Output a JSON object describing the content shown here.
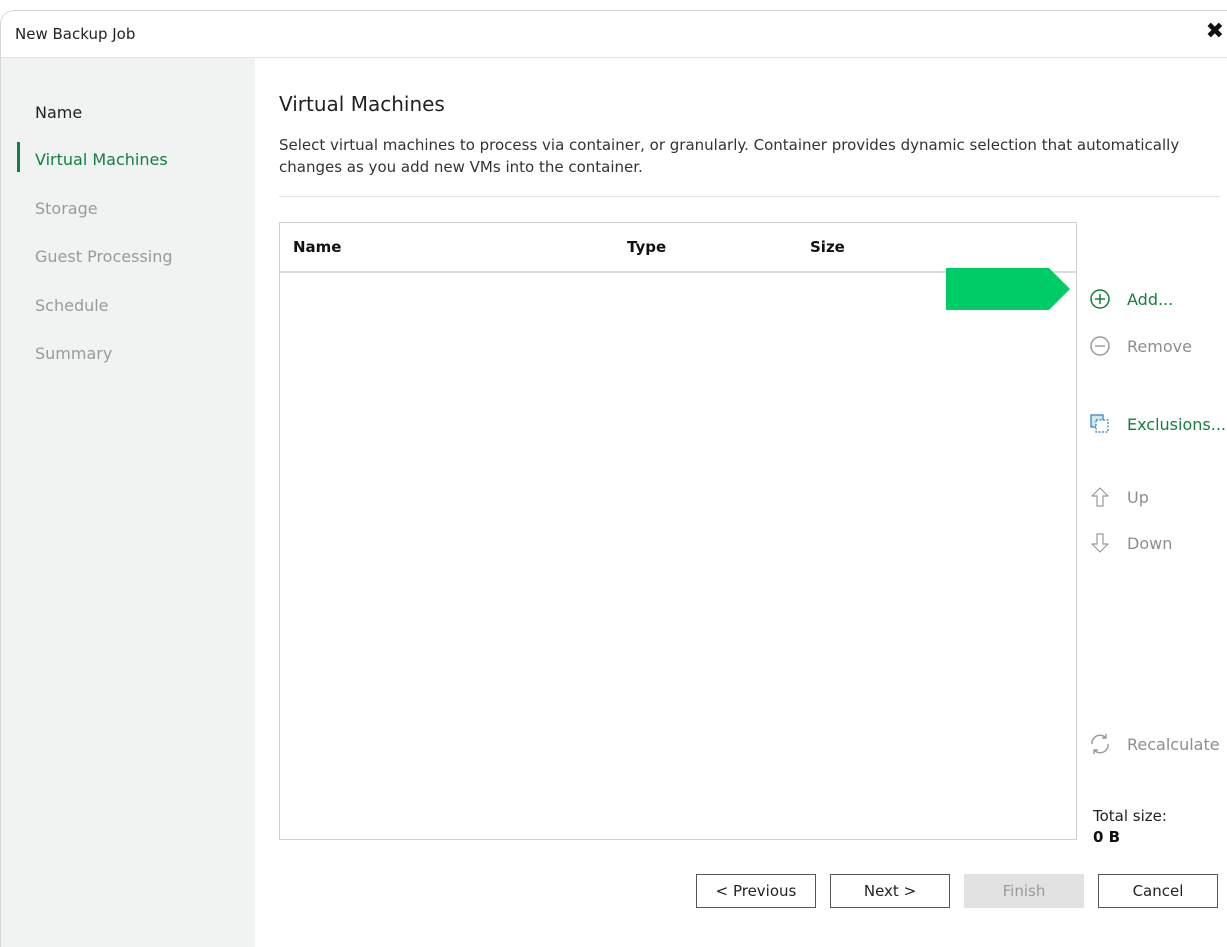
{
  "window": {
    "title": "New Backup Job"
  },
  "sidebar": {
    "steps": [
      {
        "label": "Name",
        "state": "done"
      },
      {
        "label": "Virtual Machines",
        "state": "active"
      },
      {
        "label": "Storage",
        "state": "pending"
      },
      {
        "label": "Guest Processing",
        "state": "pending"
      },
      {
        "label": "Schedule",
        "state": "pending"
      },
      {
        "label": "Summary",
        "state": "pending"
      }
    ]
  },
  "main": {
    "title": "Virtual Machines",
    "description": "Select virtual machines to process via container, or granularly. Container provides dynamic selection that automatically changes as you add new VMs into the container.",
    "table": {
      "columns": [
        "Name",
        "Type",
        "Size"
      ],
      "rows": []
    },
    "actions": {
      "add": {
        "label": "Add...",
        "icon": "plus-circle-icon"
      },
      "remove": {
        "label": "Remove",
        "icon": "minus-circle-icon"
      },
      "exclusions": {
        "label": "Exclusions...",
        "icon": "exclusions-icon"
      },
      "up": {
        "label": "Up",
        "icon": "arrow-up-icon"
      },
      "down": {
        "label": "Down",
        "icon": "arrow-down-icon"
      },
      "recalculate": {
        "label": "Recalculate",
        "icon": "refresh-icon"
      }
    },
    "total": {
      "label": "Total size:",
      "value": "0 B"
    }
  },
  "footer": {
    "previous": "< Previous",
    "next": "Next >",
    "finish": "Finish",
    "cancel": "Cancel"
  },
  "colors": {
    "accent": "#12803e",
    "highlight_arrow": "#00cc66",
    "sidebar_bg": "#f1f3f2"
  }
}
